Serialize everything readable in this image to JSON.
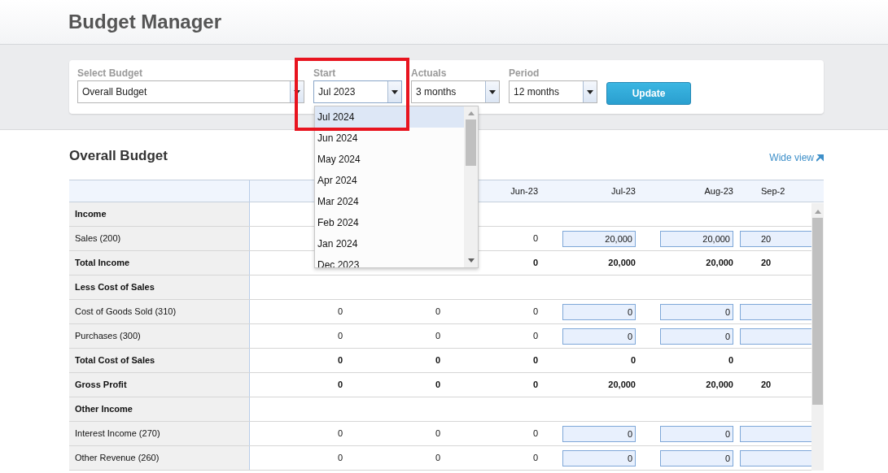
{
  "title": "Budget Manager",
  "filters": [
    {
      "label": "Select Budget",
      "value": "Overall Budget",
      "kind": "wide"
    },
    {
      "label": "Start",
      "value": "Jul 2023",
      "kind": "narrow",
      "open": true
    },
    {
      "label": "Actuals",
      "value": "3 months",
      "kind": "narrow",
      "open": false
    },
    {
      "label": "Period",
      "value": "12 months",
      "kind": "narrow",
      "open": false
    }
  ],
  "update_button": "Update",
  "dropdown": {
    "items": [
      {
        "label": "Jul 2024",
        "selected": true
      },
      {
        "label": "Jun 2024",
        "selected": false
      },
      {
        "label": "May 2024",
        "selected": false
      },
      {
        "label": "Apr 2024",
        "selected": false
      },
      {
        "label": "Mar 2024",
        "selected": false
      },
      {
        "label": "Feb 2024",
        "selected": false
      },
      {
        "label": "Jan 2024",
        "selected": false
      },
      {
        "label": "Dec 2023",
        "selected": false
      }
    ]
  },
  "section_title": "Overall Budget",
  "wide_view_link": "Wide view",
  "table": {
    "columns": [
      {
        "kind": "covered"
      },
      {
        "kind": "covered"
      },
      {
        "kind": "label",
        "label": "Jun-23"
      },
      {
        "kind": "label",
        "label": "Jul-23"
      },
      {
        "kind": "label",
        "label": "Aug-23"
      },
      {
        "kind": "cut",
        "label": "Sep-2"
      }
    ],
    "rows": [
      {
        "label": "Income",
        "kind": "section",
        "cells": []
      },
      {
        "label": "Sales (200)",
        "kind": "account",
        "cells": [
          {
            "kind": "covered"
          },
          {
            "kind": "covered"
          },
          {
            "kind": "text",
            "text": "0"
          },
          {
            "kind": "input",
            "text": "20,000"
          },
          {
            "kind": "input",
            "text": "20,000"
          },
          {
            "kind": "cut_input",
            "text": "20"
          }
        ]
      },
      {
        "label": "Total Income",
        "kind": "total",
        "cells": [
          {
            "kind": "covered"
          },
          {
            "kind": "covered"
          },
          {
            "kind": "text",
            "text": "0"
          },
          {
            "kind": "text",
            "text": "20,000"
          },
          {
            "kind": "text",
            "text": "20,000"
          },
          {
            "kind": "cut_text",
            "text": "20"
          }
        ]
      },
      {
        "label": "Less Cost of Sales",
        "kind": "section",
        "cells": []
      },
      {
        "label": "Cost of Goods Sold (310)",
        "kind": "account",
        "cells": [
          {
            "kind": "text",
            "text": "0"
          },
          {
            "kind": "text",
            "text": "0"
          },
          {
            "kind": "text",
            "text": "0"
          },
          {
            "kind": "input",
            "text": "0"
          },
          {
            "kind": "input",
            "text": "0"
          },
          {
            "kind": "cut_input"
          }
        ]
      },
      {
        "label": "Purchases (300)",
        "kind": "account",
        "cells": [
          {
            "kind": "text",
            "text": "0"
          },
          {
            "kind": "text",
            "text": "0"
          },
          {
            "kind": "text",
            "text": "0"
          },
          {
            "kind": "input",
            "text": "0"
          },
          {
            "kind": "input",
            "text": "0"
          },
          {
            "kind": "cut_input"
          }
        ]
      },
      {
        "label": "Total Cost of Sales",
        "kind": "total",
        "cells": [
          {
            "kind": "text",
            "text": "0"
          },
          {
            "kind": "text",
            "text": "0"
          },
          {
            "kind": "text",
            "text": "0"
          },
          {
            "kind": "text",
            "text": "0"
          },
          {
            "kind": "text",
            "text": "0"
          },
          {
            "kind": "covered"
          }
        ]
      },
      {
        "label": "Gross Profit",
        "kind": "total",
        "cells": [
          {
            "kind": "text",
            "text": "0"
          },
          {
            "kind": "text",
            "text": "0"
          },
          {
            "kind": "text",
            "text": "0"
          },
          {
            "kind": "text",
            "text": "20,000"
          },
          {
            "kind": "text",
            "text": "20,000"
          },
          {
            "kind": "cut_text",
            "text": "20"
          }
        ]
      },
      {
        "label": "Other Income",
        "kind": "section",
        "cells": []
      },
      {
        "label": "Interest Income (270)",
        "kind": "account",
        "cells": [
          {
            "kind": "text",
            "text": "0"
          },
          {
            "kind": "text",
            "text": "0"
          },
          {
            "kind": "text",
            "text": "0"
          },
          {
            "kind": "input",
            "text": "0"
          },
          {
            "kind": "input",
            "text": "0"
          },
          {
            "kind": "cut_input"
          }
        ]
      },
      {
        "label": "Other Revenue (260)",
        "kind": "account",
        "cells": [
          {
            "kind": "text",
            "text": "0"
          },
          {
            "kind": "text",
            "text": "0"
          },
          {
            "kind": "text",
            "text": "0"
          },
          {
            "kind": "input",
            "text": "0"
          },
          {
            "kind": "input",
            "text": "0"
          },
          {
            "kind": "cut_input"
          }
        ]
      }
    ]
  }
}
